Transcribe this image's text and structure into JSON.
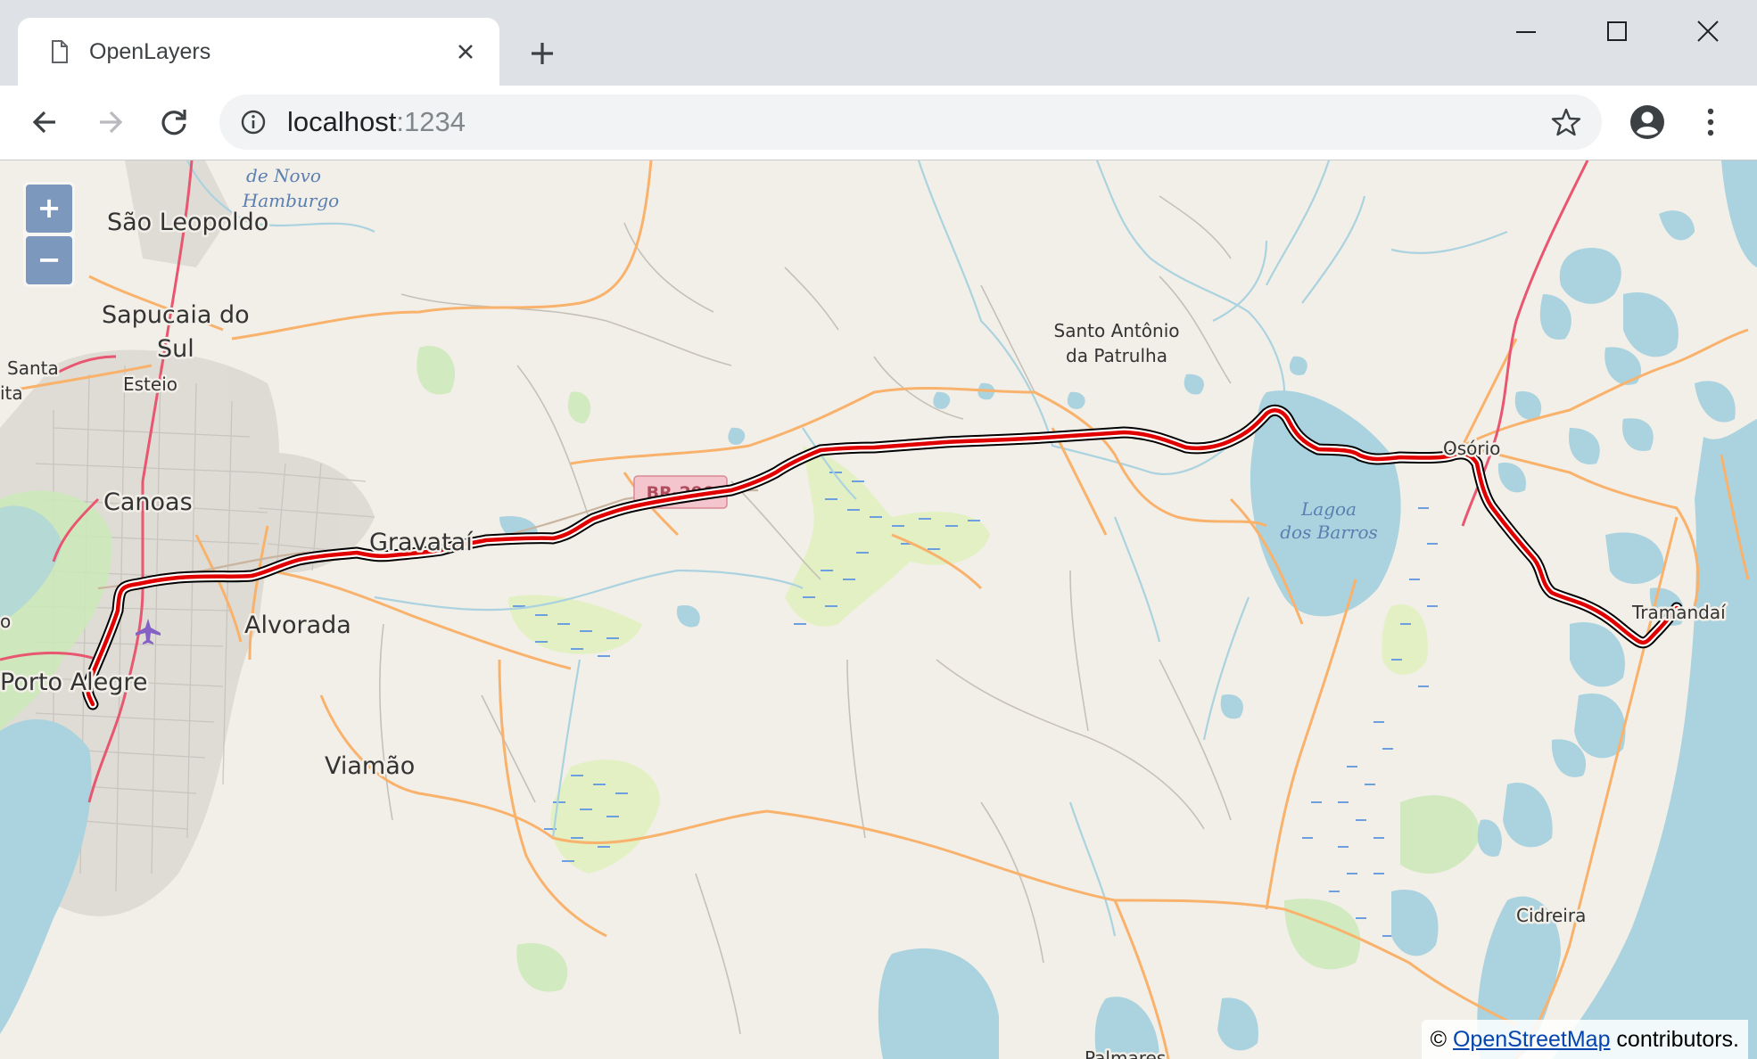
{
  "browser": {
    "tab_title": "OpenLayers",
    "url_host": "localhost",
    "url_port": ":1234"
  },
  "map": {
    "zoom_in_label": "+",
    "zoom_out_label": "−",
    "attribution_prefix": "© ",
    "attribution_link": "OpenStreetMap",
    "attribution_suffix": " contributors.",
    "labels": {
      "novo_hamburgo_1": "de Novo",
      "novo_hamburgo_2": "Hamburgo",
      "sao_leopoldo": "São Leopoldo",
      "sapucaia_1": "Sapucaia do",
      "sapucaia_2": "Sul",
      "santa": "Santa",
      "rita": "ita",
      "esteio": "Esteio",
      "canoas": "Canoas",
      "gravatai": "Gravataí",
      "alvorada": "Alvorada",
      "porto_alegre": "Porto Alegre",
      "viamao": "Viamão",
      "santo_antonio_1": "Santo Antônio",
      "santo_antonio_2": "da Patrulha",
      "lagoa_1": "Lagoa",
      "lagoa_2": "dos Barros",
      "osorio": "Osório",
      "tramandai": "Tramandaí",
      "cidreira": "Cidreira",
      "palmares": "Palmares",
      "road_shield": "BR-290",
      "left_edge": "o"
    },
    "colors": {
      "land": "#f2efe9",
      "water": "#aad3df",
      "route_outer": "#000000",
      "route_inner": "#ffffff",
      "route_core": "#e00000",
      "primary_road": "#f9b26c",
      "rail_motorway": "#e8566f"
    }
  }
}
